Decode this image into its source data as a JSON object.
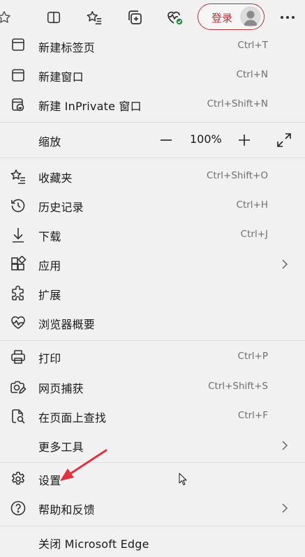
{
  "toolbar": {
    "login_label": "登录",
    "icons": [
      "favorite-star-icon",
      "split-screen-icon",
      "favorites-list-icon",
      "collections-icon",
      "browser-essentials-icon",
      "profile-avatar-icon",
      "more-menu-icon"
    ],
    "accent_color": "#b0343a",
    "status_dot_color": "#1f8f3a"
  },
  "menu": {
    "new_tab": {
      "label": "新建标签页",
      "shortcut": "Ctrl+T"
    },
    "new_window": {
      "label": "新建窗口",
      "shortcut": "Ctrl+N"
    },
    "new_inprivate": {
      "label": "新建 InPrivate 窗口",
      "shortcut": "Ctrl+Shift+N"
    },
    "zoom": {
      "label": "缩放",
      "value": "100%"
    },
    "favorites": {
      "label": "收藏夹",
      "shortcut": "Ctrl+Shift+O"
    },
    "history": {
      "label": "历史记录",
      "shortcut": "Ctrl+H"
    },
    "downloads": {
      "label": "下载",
      "shortcut": "Ctrl+J"
    },
    "apps": {
      "label": "应用"
    },
    "extensions": {
      "label": "扩展"
    },
    "essentials": {
      "label": "浏览器概要"
    },
    "print": {
      "label": "打印",
      "shortcut": "Ctrl+P"
    },
    "web_capture": {
      "label": "网页捕获",
      "shortcut": "Ctrl+Shift+S"
    },
    "find": {
      "label": "在页面上查找",
      "shortcut": "Ctrl+F"
    },
    "more_tools": {
      "label": "更多工具"
    },
    "settings": {
      "label": "设置"
    },
    "help": {
      "label": "帮助和反馈"
    },
    "close": {
      "label": "关闭 Microsoft Edge"
    }
  }
}
